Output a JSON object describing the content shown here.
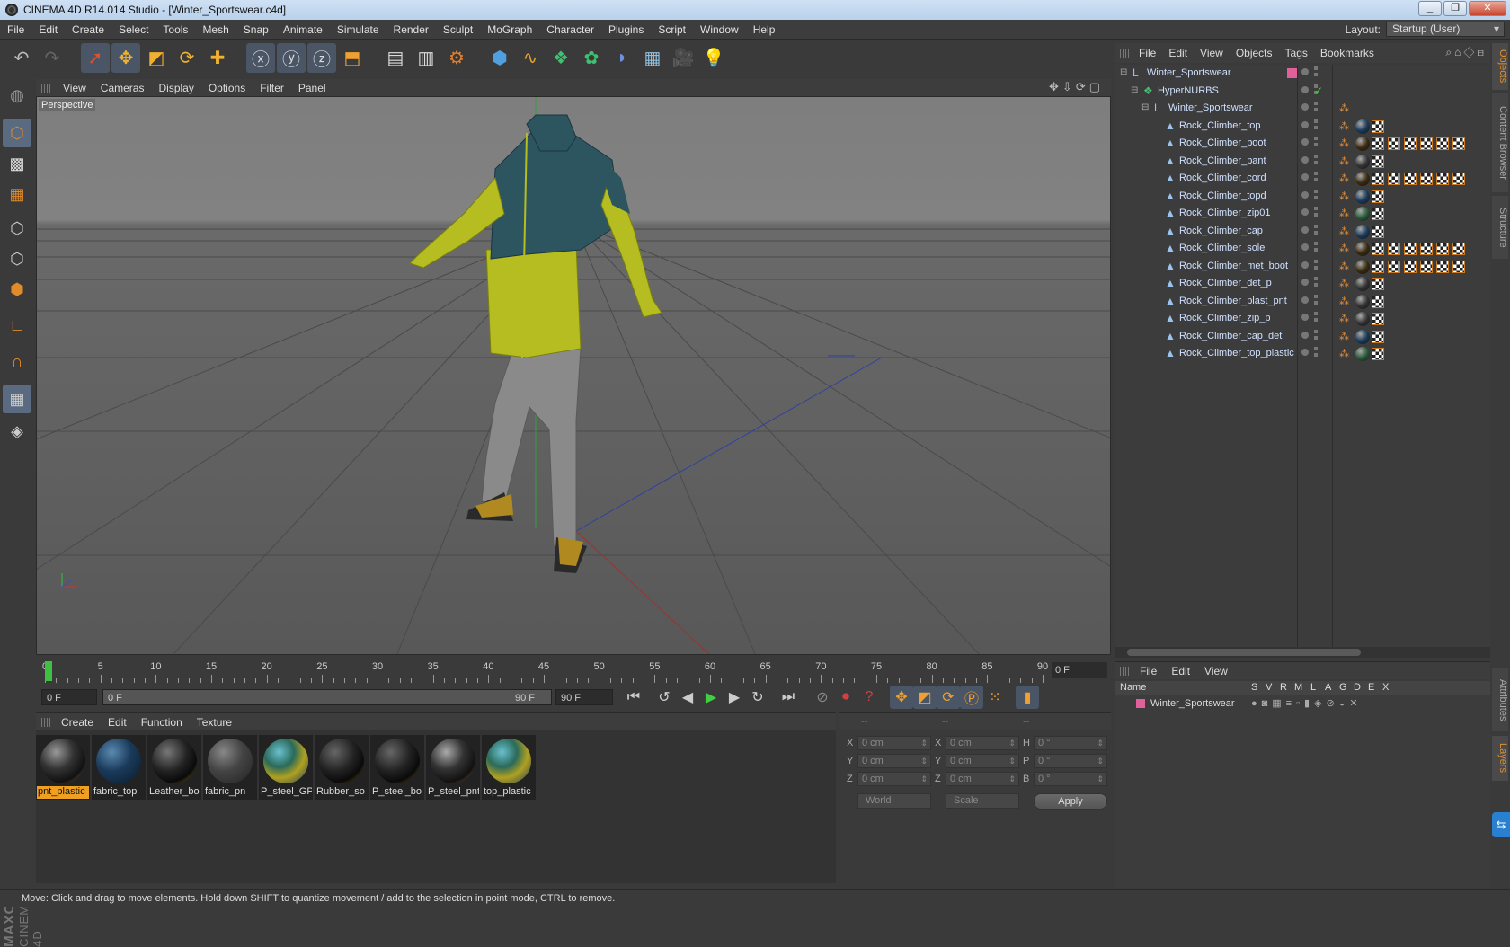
{
  "window": {
    "title": "CINEMA 4D R14.014 Studio - [Winter_Sportswear.c4d]",
    "min": "_",
    "max": "❐",
    "close": "✕"
  },
  "menu": [
    "File",
    "Edit",
    "Create",
    "Select",
    "Tools",
    "Mesh",
    "Snap",
    "Animate",
    "Simulate",
    "Render",
    "Sculpt",
    "MoGraph",
    "Character",
    "Plugins",
    "Script",
    "Window",
    "Help"
  ],
  "layout": {
    "label": "Layout:",
    "value": "Startup (User)"
  },
  "viewport": {
    "menu": [
      "View",
      "Cameras",
      "Display",
      "Options",
      "Filter",
      "Panel"
    ],
    "label": "Perspective",
    "icons": "✥⇩⟳▢"
  },
  "timeline": {
    "ticks": [
      "0",
      "5",
      "10",
      "15",
      "20",
      "25",
      "30",
      "35",
      "40",
      "45",
      "50",
      "55",
      "60",
      "65",
      "70",
      "75",
      "80",
      "85",
      "90"
    ],
    "current": "0 F",
    "start": "0 F",
    "range_start": "0 F",
    "range_end": "90 F",
    "end": "90 F"
  },
  "materials": {
    "menu": [
      "Create",
      "Edit",
      "Function",
      "Texture"
    ],
    "items": [
      {
        "name": "pnt_plastic",
        "style": "dark-plastic"
      },
      {
        "name": "fabric_top",
        "style": "blue-fabric"
      },
      {
        "name": "Leather_bo",
        "style": "leather"
      },
      {
        "name": "fabric_pn",
        "style": "grey-fabric"
      },
      {
        "name": "P_steel_GP",
        "style": "multicolor"
      },
      {
        "name": "Rubber_so",
        "style": "rubber"
      },
      {
        "name": "P_steel_bo",
        "style": "rubber"
      },
      {
        "name": "P_steel_pnt",
        "style": "dark-plastic"
      },
      {
        "name": "top_plastic",
        "style": "multicolor"
      }
    ]
  },
  "coordinates": {
    "header": [
      "--",
      "--",
      "--"
    ],
    "rows": [
      {
        "a": "X",
        "av": "0 cm",
        "b": "X",
        "bv": "0 cm",
        "c": "H",
        "cv": "0 °"
      },
      {
        "a": "Y",
        "av": "0 cm",
        "b": "Y",
        "bv": "0 cm",
        "c": "P",
        "cv": "0 °"
      },
      {
        "a": "Z",
        "av": "0 cm",
        "b": "Z",
        "bv": "0 cm",
        "c": "B",
        "cv": "0 °"
      }
    ],
    "space": "World",
    "mode": "Scale",
    "apply": "Apply"
  },
  "status": "Move: Click and drag to move elements. Hold down SHIFT to quantize movement / add to the selection in point mode, CTRL to remove.",
  "objects": {
    "menu": [
      "File",
      "Edit",
      "View",
      "Objects",
      "Tags",
      "Bookmarks"
    ],
    "icons": "⌕⌂◇⊟",
    "tree": [
      {
        "name": "Winter_Sportswear",
        "depth": 0,
        "type": "null",
        "tag": "layer"
      },
      {
        "name": "HyperNURBS",
        "depth": 1,
        "type": "nurbs",
        "tag": "check"
      },
      {
        "name": "Winter_Sportswear",
        "depth": 2,
        "type": "null",
        "tag": "phong"
      },
      {
        "name": "Rock_Climber_top",
        "depth": 3,
        "type": "poly",
        "mats": [
          "#1a3a5a",
          "chk"
        ]
      },
      {
        "name": "Rock_Climber_boot",
        "depth": 3,
        "type": "poly",
        "mats": [
          "#3a2a10",
          "chk",
          "chk",
          "chk",
          "chk",
          "chk",
          "chk"
        ]
      },
      {
        "name": "Rock_Climber_pant",
        "depth": 3,
        "type": "poly",
        "mats": [
          "#333333",
          "chk"
        ]
      },
      {
        "name": "Rock_Climber_cord",
        "depth": 3,
        "type": "poly",
        "mats": [
          "#3a2a10",
          "chk",
          "chk",
          "chk",
          "chk",
          "chk",
          "chk"
        ]
      },
      {
        "name": "Rock_Climber_topd",
        "depth": 3,
        "type": "poly",
        "mats": [
          "#1a3a5a",
          "chk"
        ]
      },
      {
        "name": "Rock_Climber_zip01",
        "depth": 3,
        "type": "poly",
        "mats": [
          "#2a5a3a",
          "chk"
        ]
      },
      {
        "name": "Rock_Climber_cap",
        "depth": 3,
        "type": "poly",
        "mats": [
          "#1a3a5a",
          "chk"
        ]
      },
      {
        "name": "Rock_Climber_sole",
        "depth": 3,
        "type": "poly",
        "mats": [
          "#3a2a10",
          "chk",
          "chk",
          "chk",
          "chk",
          "chk",
          "chk"
        ]
      },
      {
        "name": "Rock_Climber_met_boot",
        "depth": 3,
        "type": "poly",
        "mats": [
          "#3a2a10",
          "chk",
          "chk",
          "chk",
          "chk",
          "chk",
          "chk"
        ]
      },
      {
        "name": "Rock_Climber_det_p",
        "depth": 3,
        "type": "poly",
        "mats": [
          "#333333",
          "chk"
        ]
      },
      {
        "name": "Rock_Climber_plast_pnt",
        "depth": 3,
        "type": "poly",
        "mats": [
          "#333333",
          "chk"
        ]
      },
      {
        "name": "Rock_Climber_zip_p",
        "depth": 3,
        "type": "poly",
        "mats": [
          "#333333",
          "chk"
        ]
      },
      {
        "name": "Rock_Climber_cap_det",
        "depth": 3,
        "type": "poly",
        "mats": [
          "#1a3a5a",
          "chk"
        ]
      },
      {
        "name": "Rock_Climber_top_plastic",
        "depth": 3,
        "type": "poly",
        "mats": [
          "#2a5a3a",
          "chk"
        ]
      }
    ]
  },
  "layers": {
    "menu": [
      "File",
      "Edit",
      "View"
    ],
    "columns": [
      "Name",
      "S",
      "V",
      "R",
      "M",
      "L",
      "A",
      "G",
      "D",
      "E",
      "X"
    ],
    "rows": [
      {
        "name": "Winter_Sportswear",
        "color": "#e0609a"
      }
    ]
  },
  "sidetabs": [
    "Objects",
    "Content Browser",
    "Structure",
    "Attributes",
    "Layers"
  ],
  "colors": {
    "accent": "#e0902e",
    "selected_material": "#f0a020",
    "layer_color": "#e0609a"
  }
}
